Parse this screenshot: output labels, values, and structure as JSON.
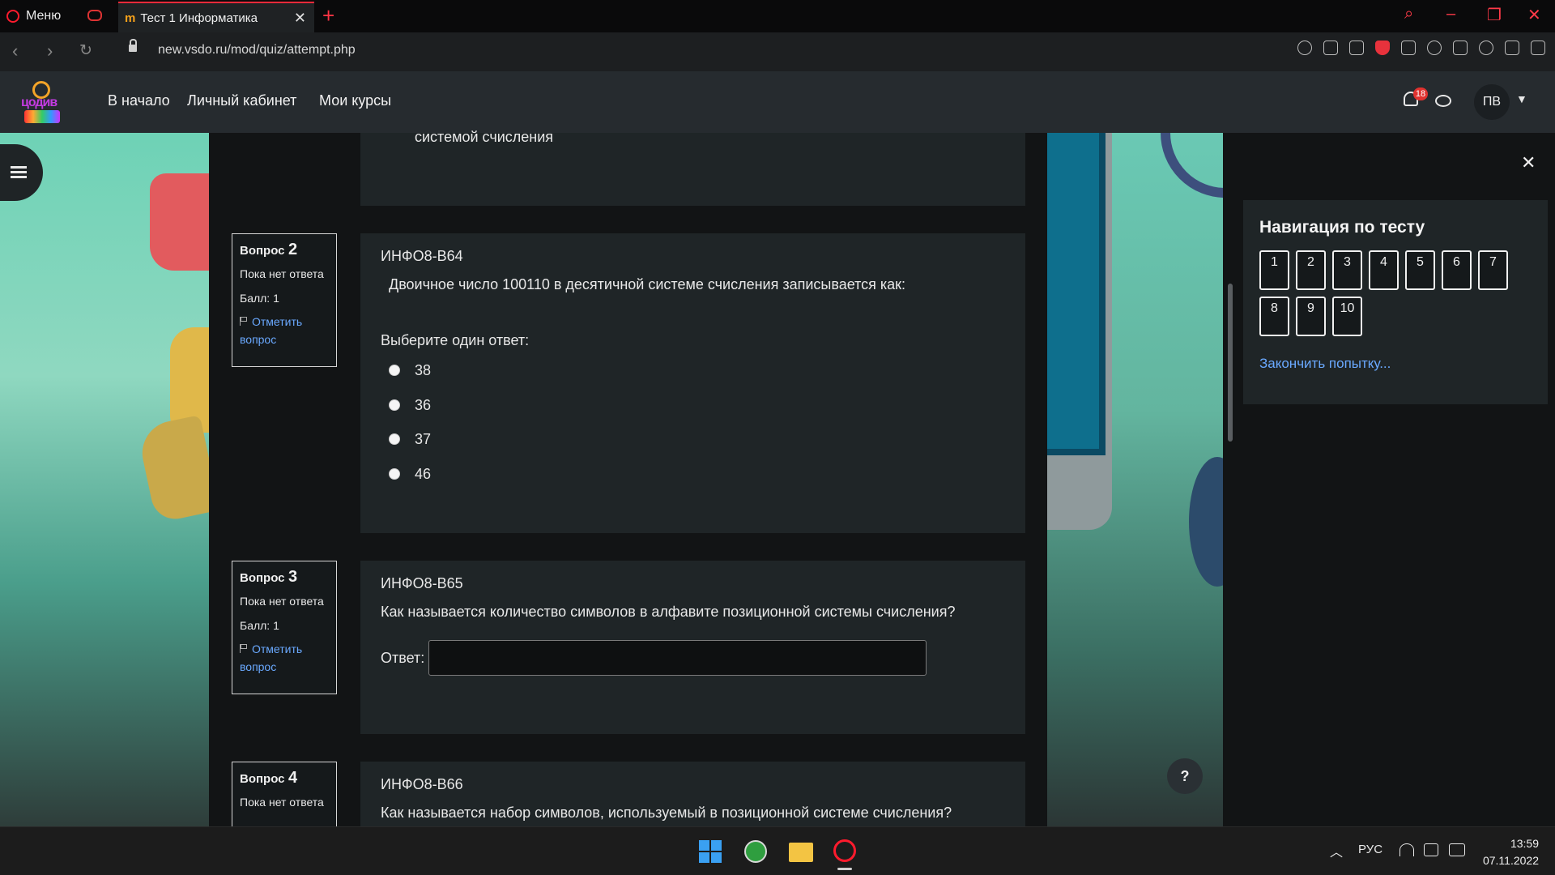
{
  "browser": {
    "menu_label": "Меню",
    "tab_title": "Тест 1 Информатика",
    "tab_favicon": "m",
    "url": "new.vsdo.ru/mod/quiz/attempt.php",
    "accent": "#ff1b2d"
  },
  "header": {
    "logo_text": "цодив",
    "nav": [
      "В начало",
      "Личный кабинет",
      "Мои курсы"
    ],
    "notifications_count": "18",
    "user_initials": "ПВ"
  },
  "prev_fragment": "системой счисления",
  "questions": [
    {
      "label": "Вопрос",
      "number": "2",
      "status": "Пока нет ответа",
      "score": "Балл: 1",
      "flag": "Отметить вопрос",
      "code": "ИНФО8-В64",
      "text": "Двоичное число 100110 в десятичной системе счисления записывается как:",
      "prompt": "Выберите один ответ:",
      "options": [
        "38",
        "36",
        "37",
        "46"
      ]
    },
    {
      "label": "Вопрос",
      "number": "3",
      "status": "Пока нет ответа",
      "score": "Балл: 1",
      "flag": "Отметить вопрос",
      "code": "ИНФО8-В65",
      "text": "Как называется количество символов в алфавите позиционной системы счисления?",
      "answer_label": "Ответ:",
      "answer_value": ""
    },
    {
      "label": "Вопрос",
      "number": "4",
      "status": "Пока нет ответа",
      "code": "ИНФО8-В66",
      "text": "Как называется набор символов, используемый в позиционной системе счисления?"
    }
  ],
  "quiz_nav": {
    "title": "Навигация по тесту",
    "buttons": [
      "1",
      "2",
      "3",
      "4",
      "5",
      "6",
      "7",
      "8",
      "9",
      "10"
    ],
    "finish": "Закончить попытку..."
  },
  "help_label": "?",
  "taskbar": {
    "language": "РУС",
    "time": "13:59",
    "date": "07.11.2022"
  }
}
